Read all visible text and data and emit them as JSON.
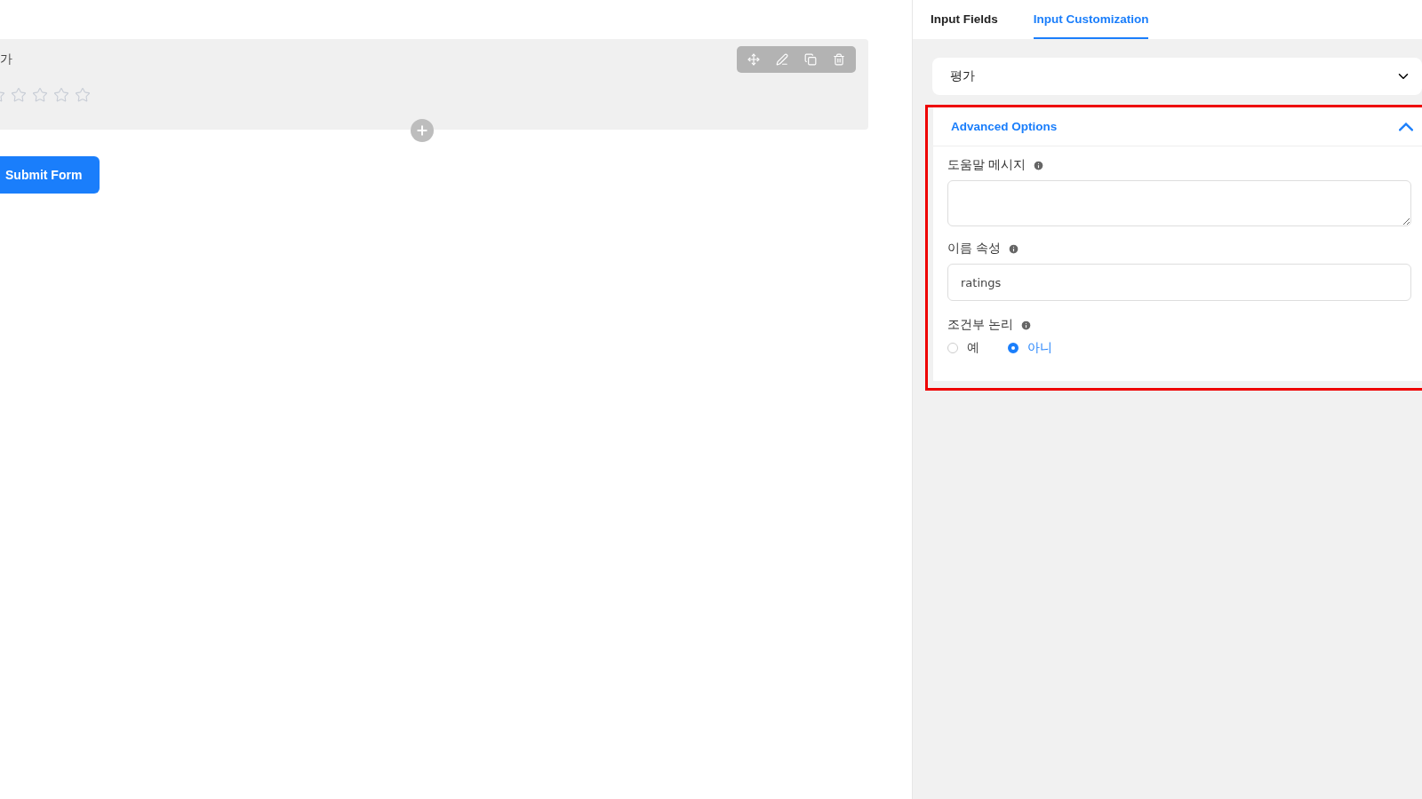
{
  "canvas": {
    "field": {
      "label": "가",
      "stars": 0
    },
    "submit": "Submit Form"
  },
  "tabs": [
    {
      "label": "Input Fields",
      "selected": false
    },
    {
      "label": "Input Customization",
      "selected": true
    }
  ],
  "field_select": {
    "value": "평가",
    "expanded": false
  },
  "advanced": {
    "title": "Advanced Options",
    "expanded": true,
    "highlighted": true,
    "help": {
      "label": "도움말 메시지"
    },
    "name_attr": {
      "label": "이름 속성",
      "value": "ratings"
    },
    "conditional": {
      "label": "조건부 논리",
      "options": [
        {
          "label": "예",
          "selected": false
        },
        {
          "label": "아니",
          "selected": true
        }
      ]
    }
  }
}
